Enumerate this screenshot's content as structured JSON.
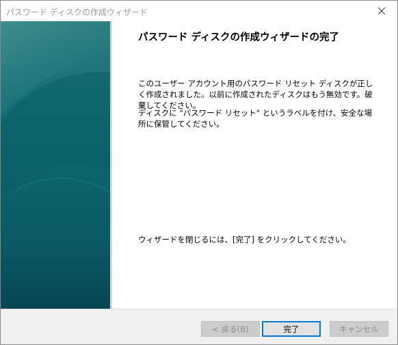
{
  "window": {
    "title": "パスワード ディスクの作成ウィザード",
    "close_icon": "close-icon"
  },
  "content": {
    "heading": "パスワード ディスクの作成ウィザードの完了",
    "paragraph1": "このユーザー アカウント用のパスワード リセット ディスクが正しく作成されました。以前に作成されたディスクはもう無効です。破棄してください。",
    "paragraph2": "ディスクに \"パスワード リセット\" というラベルを付け、安全な場所に保管してください。",
    "paragraph3": "ウィザードを閉じるには、[完了] をクリックしてください。"
  },
  "footer": {
    "back_label": "< 戻る(B)",
    "back_enabled": false,
    "finish_label": "完了",
    "cancel_label": "キャンセル",
    "cancel_enabled": false
  },
  "colors": {
    "banner_top": "#2e7f80",
    "banner_bottom": "#0a5262",
    "default_button_border": "#0078d7"
  }
}
